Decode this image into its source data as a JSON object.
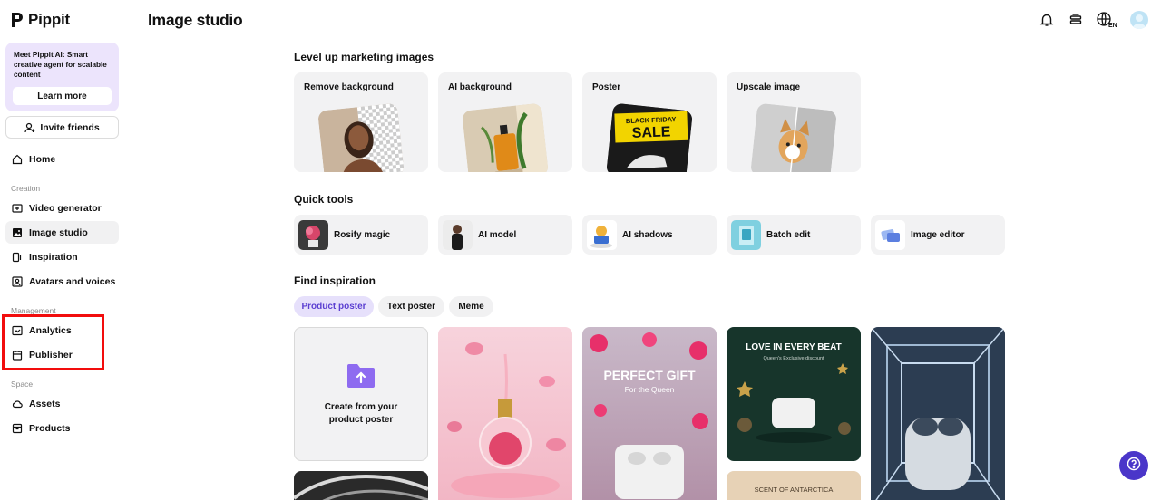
{
  "app": {
    "name": "Pippit"
  },
  "promo": {
    "text": "Meet Pippit AI: Smart creative agent for scalable content",
    "button": "Learn more"
  },
  "invite": {
    "label": "Invite friends"
  },
  "nav": {
    "home": "Home",
    "creation_label": "Creation",
    "video_generator": "Video generator",
    "image_studio": "Image studio",
    "inspiration": "Inspiration",
    "avatars_voices": "Avatars and voices",
    "management_label": "Management",
    "analytics": "Analytics",
    "publisher": "Publisher",
    "space_label": "Space",
    "assets": "Assets",
    "products": "Products"
  },
  "header": {
    "title": "Image studio",
    "language": "EN"
  },
  "marketing": {
    "heading": "Level up marketing images",
    "cards": [
      {
        "label": "Remove background"
      },
      {
        "label": "AI background"
      },
      {
        "label": "Poster",
        "art_text_1": "BLACK FRIDAY",
        "art_text_2": "SALE"
      },
      {
        "label": "Upscale image"
      }
    ]
  },
  "quick_tools": {
    "heading": "Quick tools",
    "items": [
      {
        "label": "Rosify magic"
      },
      {
        "label": "AI model"
      },
      {
        "label": "AI shadows"
      },
      {
        "label": "Batch edit"
      },
      {
        "label": "Image editor"
      }
    ]
  },
  "inspiration": {
    "heading": "Find inspiration",
    "tabs": [
      {
        "label": "Product poster",
        "selected": true
      },
      {
        "label": "Text poster",
        "selected": false
      },
      {
        "label": "Meme",
        "selected": false
      }
    ],
    "create_card": {
      "line1": "Create from your",
      "line2": "product poster"
    },
    "poster_gift": {
      "title": "PERFECT GIFT",
      "subtitle": "For the Queen"
    },
    "poster_love": {
      "title": "LOVE IN EVERY BEAT",
      "subtitle": "Queen's Exclusive discount"
    },
    "poster_scent": {
      "title": "SCENT OF ANTARCTICA"
    }
  },
  "colors": {
    "accent": "#5b3fd1",
    "highlight": "#f20d0d",
    "promo_bg": "#ece4fc"
  }
}
